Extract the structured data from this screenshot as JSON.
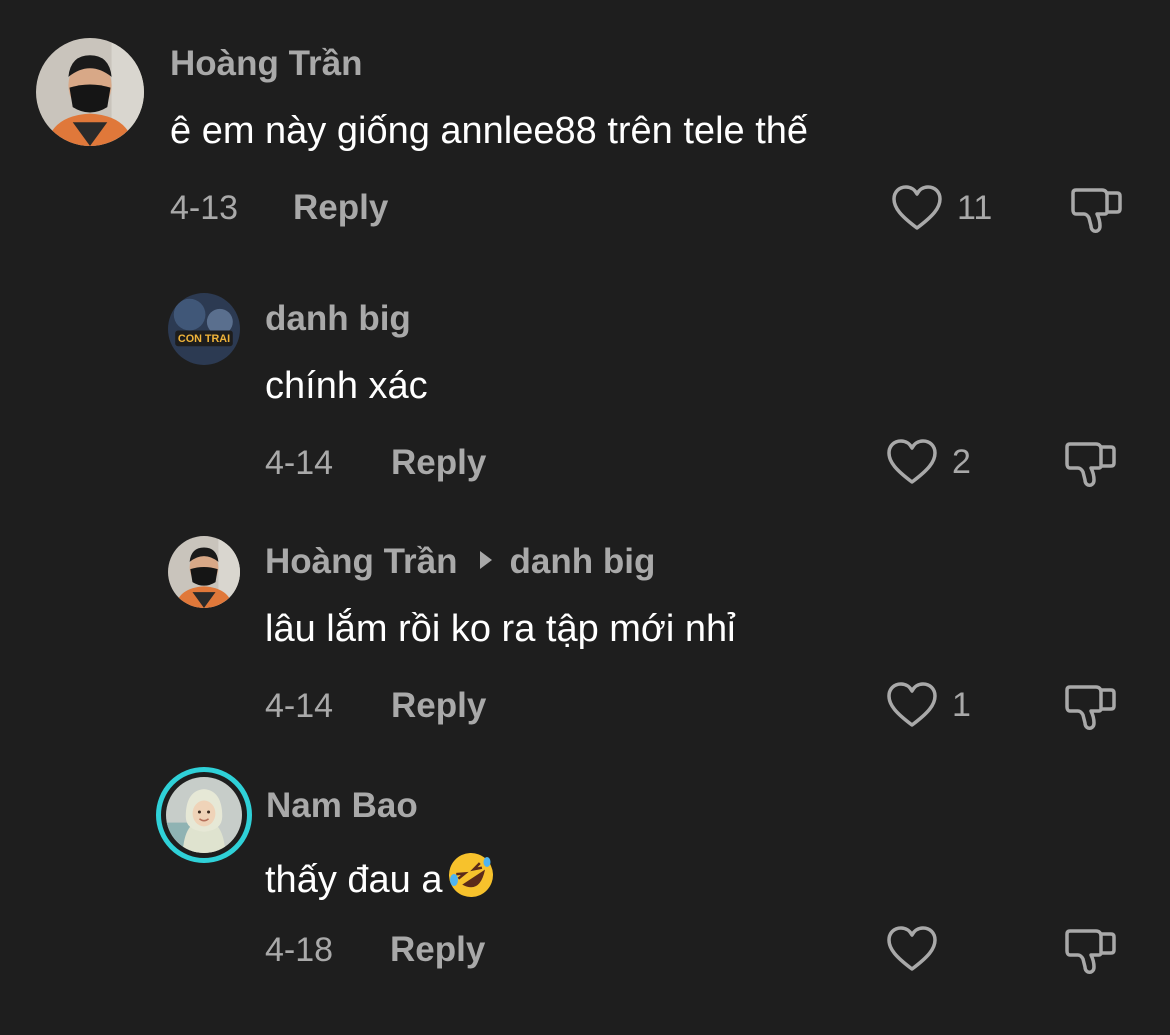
{
  "comments": [
    {
      "username": "Hoàng Trần",
      "text": "ê em này giống annlee88 trên tele thế",
      "date": "4-13",
      "reply_label": "Reply",
      "likes": "11"
    },
    {
      "username": "danh big",
      "avatar_text": "CON TRAI",
      "text": "chính xác",
      "date": "4-14",
      "reply_label": "Reply",
      "likes": "2"
    },
    {
      "username": "Hoàng Trần",
      "reply_to": "danh big",
      "text": "lâu lắm rồi ko ra tập mới nhỉ",
      "date": "4-14",
      "reply_label": "Reply",
      "likes": "1"
    },
    {
      "username": "Nam Bao",
      "text": "thấy đau a",
      "emoji": "rolling-on-floor-laughing",
      "date": "4-18",
      "reply_label": "Reply",
      "likes": ""
    }
  ],
  "colors": {
    "background": "#1e1e1e",
    "text": "#ffffff",
    "muted": "#a9a9a9",
    "story_ring": "#2fd1d8"
  },
  "icons": {
    "like": "heart-outline-icon",
    "dislike": "thumbs-down-outline-icon",
    "reply_to": "triangle-right-icon"
  }
}
